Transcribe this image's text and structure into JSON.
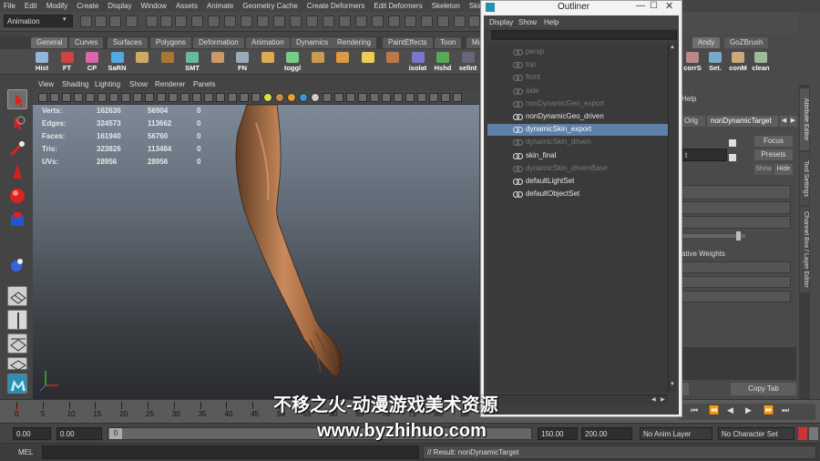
{
  "menubar": [
    "File",
    "Edit",
    "Modify",
    "Create",
    "Display",
    "Window",
    "Assets",
    "Animate",
    "Geometry Cache",
    "Create Deformers",
    "Edit Deformers",
    "Skeleton",
    "Skin"
  ],
  "status": {
    "mode": "Animation"
  },
  "shelf_tabs": [
    "General",
    "Curves",
    "Surfaces",
    "Polygons",
    "Deformation",
    "Animation",
    "Dynamics",
    "Rendering",
    "PaintEffects",
    "Toon",
    "Mu"
  ],
  "shelf_tabs_right": [
    "Andy",
    "GoZBrush"
  ],
  "shelf_buttons": [
    "Hist",
    "FT",
    "CP",
    "SaRN",
    "",
    "",
    "SMT",
    "",
    "FN",
    "",
    "toggl",
    "",
    "",
    "",
    "",
    "isolat",
    "Hshd",
    "selInt"
  ],
  "shelf_buttons_right": [
    "corrS",
    "Set.",
    "conM",
    "clean"
  ],
  "panel_menu": [
    "View",
    "Shading",
    "Lighting",
    "Show",
    "Renderer",
    "Panels"
  ],
  "hud": [
    {
      "label": "Verts:",
      "a": "162636",
      "b": "56904",
      "c": "0"
    },
    {
      "label": "Edges:",
      "a": "324573",
      "b": "113662",
      "c": "0"
    },
    {
      "label": "Faces:",
      "a": "161940",
      "b": "56760",
      "c": "0"
    },
    {
      "label": "Tris:",
      "a": "323826",
      "b": "113484",
      "c": "0"
    },
    {
      "label": "UVs:",
      "a": "28956",
      "b": "28956",
      "c": "0"
    }
  ],
  "outliner": {
    "title": "Outliner",
    "menu": [
      "Display",
      "Show",
      "Help"
    ],
    "items": [
      {
        "name": "persp",
        "dim": true,
        "selected": false
      },
      {
        "name": "top",
        "dim": true,
        "selected": false
      },
      {
        "name": "front",
        "dim": true,
        "selected": false
      },
      {
        "name": "side",
        "dim": true,
        "selected": false
      },
      {
        "name": "nonDynamicGeo_export",
        "dim": true,
        "selected": false
      },
      {
        "name": "nonDynamicGeo_driven",
        "dim": false,
        "selected": false
      },
      {
        "name": "dynamicSkin_export",
        "dim": false,
        "selected": true
      },
      {
        "name": "dynamicSkin_driven",
        "dim": true,
        "selected": false
      },
      {
        "name": "skin_final",
        "dim": false,
        "selected": false
      },
      {
        "name": "dynamicSkin_drivenBase",
        "dim": true,
        "selected": false
      },
      {
        "name": "defaultLightSet",
        "dim": false,
        "selected": false
      },
      {
        "name": "defaultObjectSet",
        "dim": false,
        "selected": false
      }
    ]
  },
  "attr_editor": {
    "help": "Help",
    "orig_tab": "Orig",
    "target_tab": "nonDynamicTarget",
    "focus": "Focus",
    "presets": "Presets",
    "show": "Show",
    "hide": "Hide",
    "t_label": "t",
    "weights_label": "ative Weights",
    "copy_tab": "Copy Tab",
    "side_tabs": [
      "Attribute Editor",
      "Tool Settings",
      "Channel Box / Layer Editor"
    ]
  },
  "timeline": {
    "ticks": [
      "0",
      "5",
      "10",
      "15",
      "20",
      "25",
      "30",
      "35",
      "40",
      "45",
      "50",
      "55",
      "60",
      "65",
      "70",
      "75",
      "80",
      "85",
      "90",
      "95",
      "100",
      "105",
      "110",
      "115",
      "120",
      "125"
    ]
  },
  "range": {
    "start": "0.00",
    "current": "0.00",
    "slider_value": "0",
    "end1": "150.00",
    "end2": "200.00",
    "anim_layer": "No Anim Layer",
    "char_set": "No Character Set"
  },
  "cmdline": {
    "label": "MEL",
    "result": "// Result: nonDynamicTarget"
  },
  "watermark": {
    "line1": "不移之火-动漫游戏美术资源",
    "line2": "www.byzhihuo.com"
  }
}
